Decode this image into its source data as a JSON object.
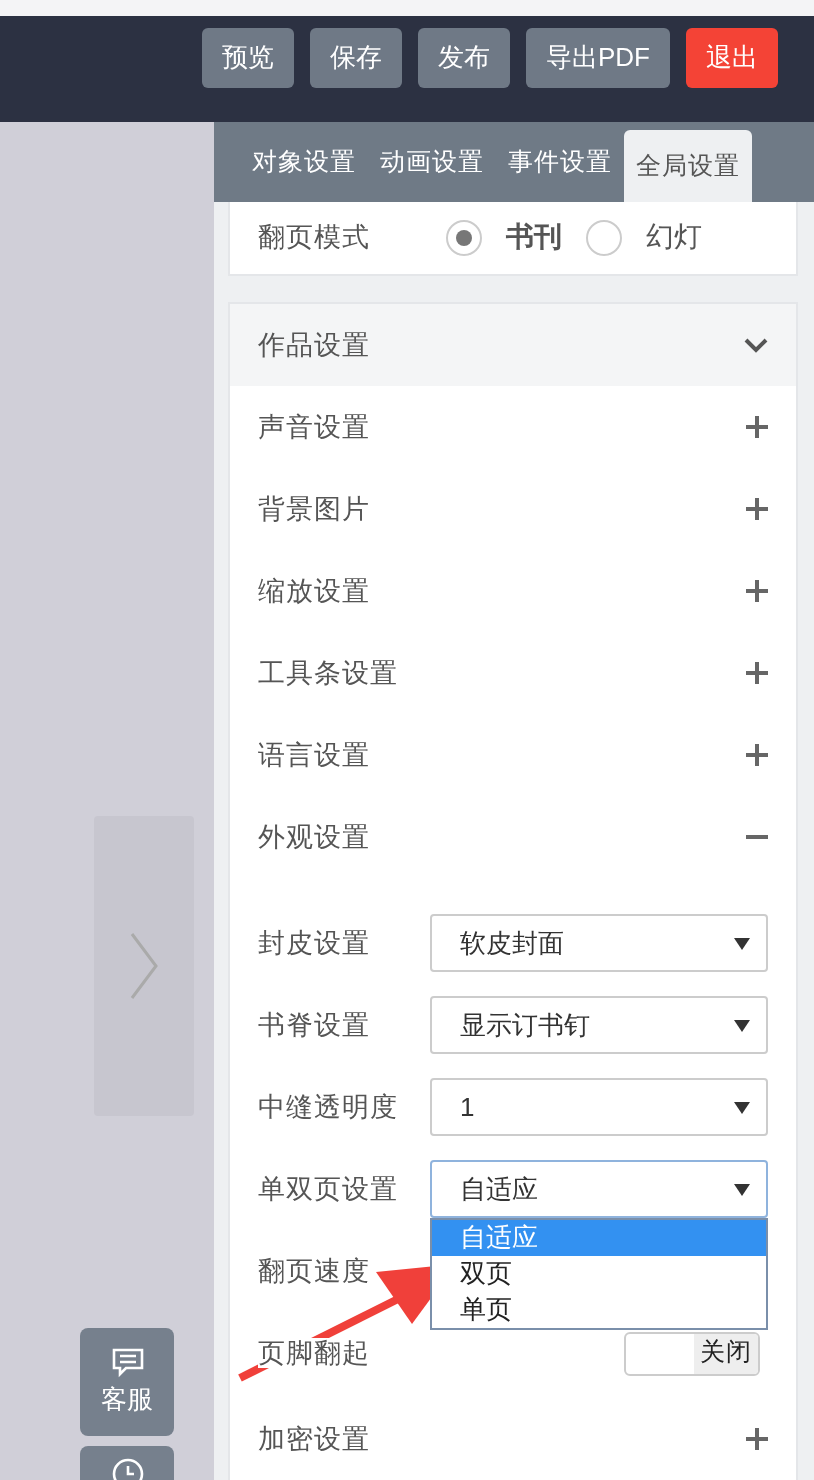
{
  "toolbar": {
    "buttons": [
      {
        "label": "预览",
        "kind": "normal"
      },
      {
        "label": "保存",
        "kind": "normal"
      },
      {
        "label": "发布",
        "kind": "normal"
      },
      {
        "label": "导出PDF",
        "kind": "normal"
      },
      {
        "label": "退出",
        "kind": "danger"
      }
    ]
  },
  "tabs": [
    {
      "label": "对象设置",
      "selected": false
    },
    {
      "label": "动画设置",
      "selected": false
    },
    {
      "label": "事件设置",
      "selected": false
    },
    {
      "label": "全局设置",
      "selected": true
    }
  ],
  "page_mode": {
    "label": "翻页模式",
    "options": [
      {
        "label": "书刊",
        "selected": true
      },
      {
        "label": "幻灯",
        "selected": false
      }
    ]
  },
  "work_settings": {
    "title": "作品设置",
    "expanded": true,
    "sections": [
      {
        "title": "声音设置",
        "expanded": false
      },
      {
        "title": "背景图片",
        "expanded": false
      },
      {
        "title": "缩放设置",
        "expanded": false
      },
      {
        "title": "工具条设置",
        "expanded": false
      },
      {
        "title": "语言设置",
        "expanded": false
      },
      {
        "title": "外观设置",
        "expanded": true,
        "fields": [
          {
            "label": "封皮设置",
            "kind": "select",
            "value": "软皮封面",
            "open": false
          },
          {
            "label": "书脊设置",
            "kind": "select",
            "value": "显示订书钉",
            "open": false
          },
          {
            "label": "中缝透明度",
            "kind": "select",
            "value": "1",
            "open": false
          },
          {
            "label": "单双页设置",
            "kind": "select",
            "value": "自适应",
            "open": true,
            "options": [
              {
                "label": "自适应",
                "selected": true
              },
              {
                "label": "双页",
                "selected": false
              },
              {
                "label": "单页",
                "selected": false
              }
            ]
          },
          {
            "label": "翻页速度",
            "kind": "label"
          },
          {
            "label": "页脚翻起",
            "kind": "toggle",
            "on": false,
            "state_text": "关闭"
          }
        ]
      },
      {
        "title": "加密设置",
        "expanded": false
      }
    ]
  },
  "side_buttons": [
    {
      "kind": "chat",
      "label": "客服"
    },
    {
      "kind": "clock"
    }
  ]
}
